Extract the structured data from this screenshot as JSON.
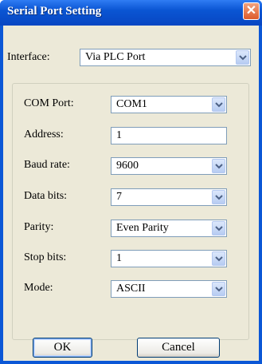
{
  "window": {
    "title": "Serial Port Setting",
    "close_label": "✕"
  },
  "interface": {
    "label": "Interface:",
    "value": "Via PLC Port"
  },
  "fields": {
    "com_port": {
      "label": "COM Port:",
      "value": "COM1"
    },
    "address": {
      "label": "Address:",
      "value": "1"
    },
    "baud_rate": {
      "label": "Baud rate:",
      "value": "9600"
    },
    "data_bits": {
      "label": "Data bits:",
      "value": "7"
    },
    "parity": {
      "label": "Parity:",
      "value": "Even Parity"
    },
    "stop_bits": {
      "label": "Stop bits:",
      "value": "1"
    },
    "mode": {
      "label": "Mode:",
      "value": "ASCII"
    }
  },
  "buttons": {
    "ok": "OK",
    "cancel": "Cancel"
  },
  "colors": {
    "titlebar": "#0a55d3",
    "client": "#ece9d8",
    "close": "#dd5b2b",
    "field_border": "#7f9db9"
  },
  "icons": {
    "close": "close-icon",
    "dropdown": "chevron-down-icon"
  }
}
